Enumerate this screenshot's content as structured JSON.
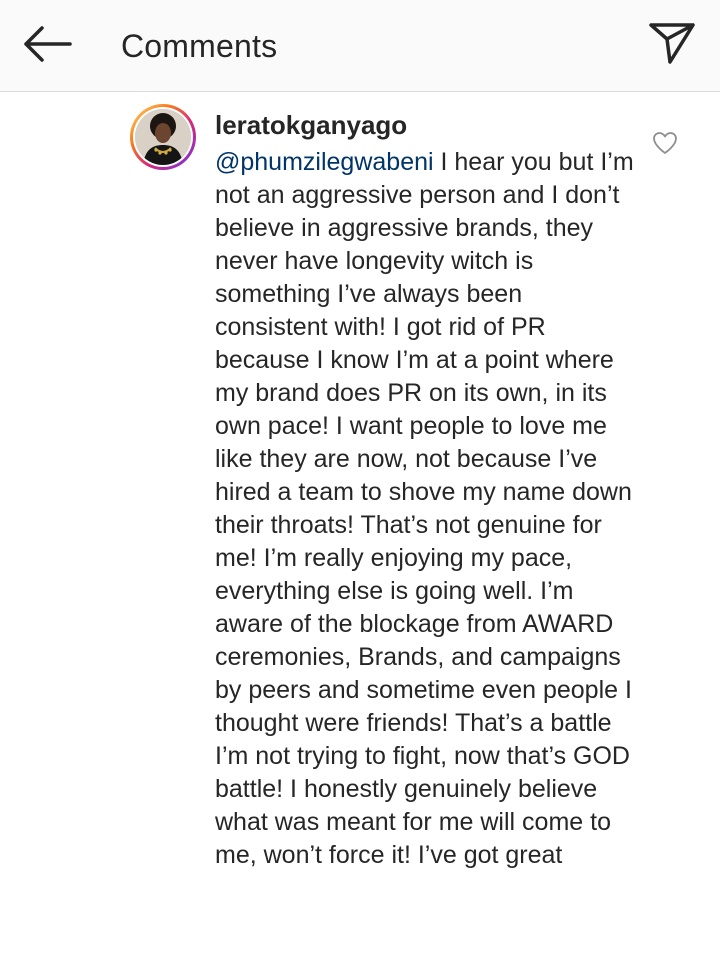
{
  "header": {
    "title": "Comments",
    "back_icon": "arrow-left-icon",
    "share_icon": "paper-plane-icon"
  },
  "comment": {
    "username": "leratokganyago",
    "mention": "@phumzilegwabeni",
    "text": " I hear you but I’m not an aggressive person and I don’t believe in aggressive brands, they never have longevity witch is something I’ve always been consistent with! I got rid of PR because I know I’m at a point where my brand does PR on its own, in its own pace! I want people to love me like they are now, not because I’ve hired a team to shove my name down their throats! That’s not genuine for me! I’m really enjoying my pace, everything else is going well. I’m aware of the blockage from AWARD ceremonies, Brands, and campaigns by peers and sometime even people I thought were friends! That’s a battle I’m not trying to fight, now that’s GOD battle! I honestly genuinely believe what was meant for me will come to me, won’t force it! I’ve got great",
    "like_icon": "heart-outline-icon"
  },
  "colors": {
    "header_bg": "#fafafa",
    "text": "#262626",
    "mention": "#003569",
    "icon": "#262626",
    "like_icon": "#8e8e8e"
  }
}
